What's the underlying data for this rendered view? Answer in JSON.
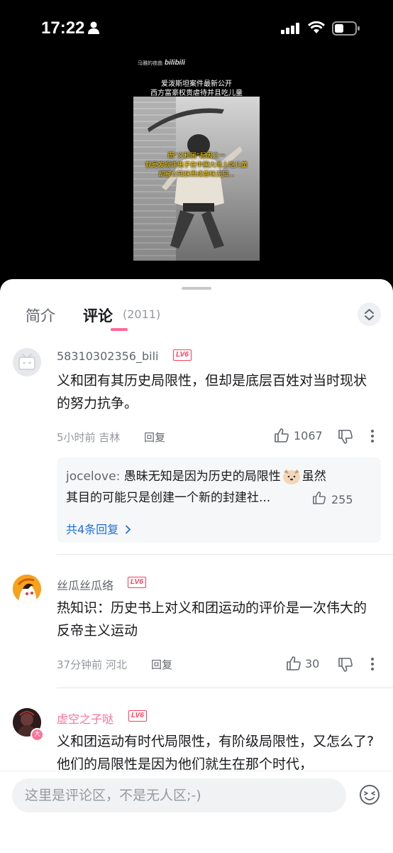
{
  "status_bar": {
    "time": "17:22"
  },
  "video": {
    "watermark": "马雅的夜曲",
    "watermark_brand": "bilibili",
    "title_lines": [
      "爱泼斯坦案件最新公开",
      "西方富豪权贵虐待并且吃儿童"
    ],
    "caption_lines": [
      "而“义和团”起因之一",
      "就是发现洋鬼子在中国大地上吃儿童",
      "却被公知抹黑成愚昧无知..."
    ]
  },
  "tabs": {
    "intro": "简介",
    "comments": "评论",
    "count": "(2011)"
  },
  "comments": [
    {
      "username": "58310302356_bili",
      "level": "LV6",
      "text": "义和团有其历史局限性，但却是底层百姓对当时现状的努力抗争。",
      "time_location": "5小时前 吉林",
      "reply": "回复",
      "likes": "1067",
      "sub_reply": {
        "user": "jocelove:",
        "line1": "愚昧无知是因为历史的局限性",
        "line1_end": "虽然",
        "line2": "其目的可能只是创建一个新的封建社...",
        "likes": "255",
        "total": "共4条回复"
      }
    },
    {
      "username": "丝瓜丝瓜络",
      "level": "LV6",
      "text": "热知识：历史书上对义和团运动的评价是一次伟大的反帝主义运动",
      "time_location": "37分钟前 河北",
      "reply": "回复",
      "likes": "30"
    },
    {
      "username": "虚空之子哒",
      "level": "LV6",
      "text": "义和团运动有时代局限性，有阶级局限性，又怎么了?他们的局限性是因为他们就生在那个时代，",
      "avatar_badge": "大"
    }
  ],
  "input": {
    "placeholder": "这里是评论区，不是无人区;-)"
  },
  "colors": {
    "accent": "#ff6699",
    "level_badge": "#ff3b5c",
    "vip_name": "#fb7299",
    "link": "#1e6fd9"
  }
}
